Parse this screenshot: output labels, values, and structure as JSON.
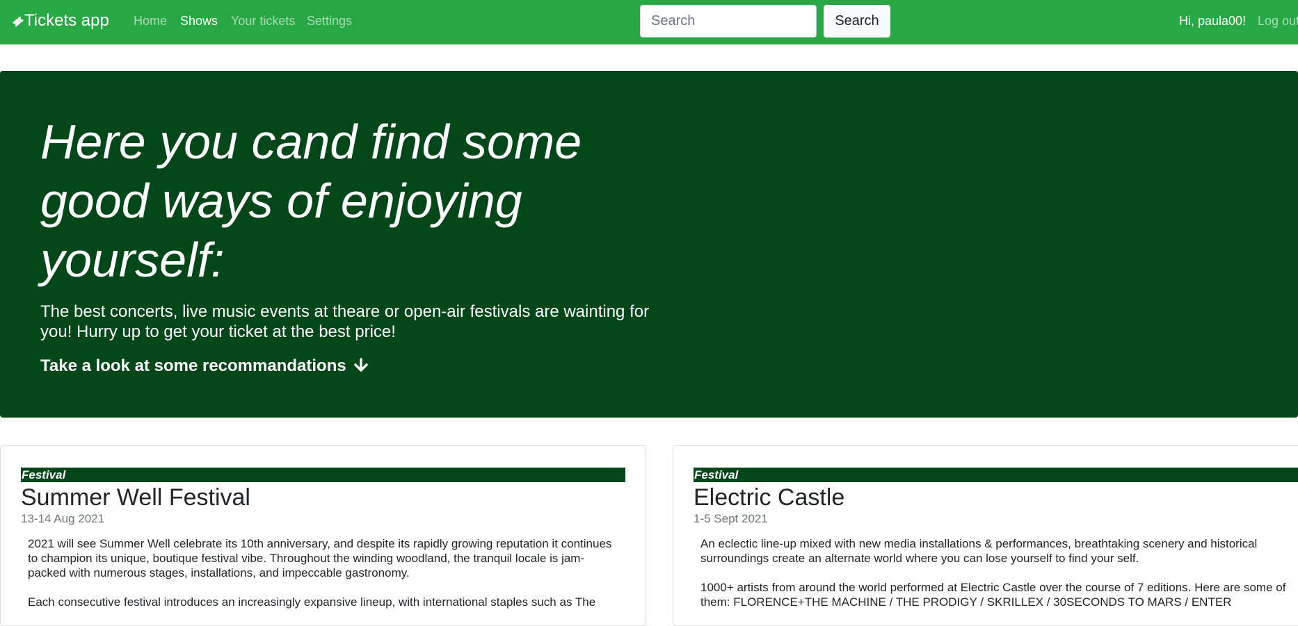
{
  "navbar": {
    "brand": "Tickets app",
    "brand_icon": "ticket-icon",
    "links": [
      "Home",
      "Shows",
      "Your tickets",
      "Settings"
    ],
    "active_link": "Shows",
    "search_placeholder": "Search",
    "search_button": "Search",
    "greeting": "Hi, paula00!",
    "logout": "Log out"
  },
  "hero": {
    "title": "Here you cand find some good ways of enjoying yourself:",
    "lead": "The best concerts, live music events at theare or open-air festivals are wainting for you! Hurry up to get your ticket at the best price!",
    "cta": "Take a look at some recommandations",
    "cta_icon": "arrow-down-icon"
  },
  "cards": [
    {
      "category": "Festival",
      "title": "Summer Well Festival",
      "date": "13-14 Aug 2021",
      "paragraphs": [
        "2021 will see Summer Well celebrate its 10th anniversary, and despite its rapidly growing reputation it continues to champion its unique, boutique festival vibe. Throughout the winding woodland, the tranquil locale is jam-packed with numerous stages, installations, and impeccable gastronomy.",
        "Each consecutive festival introduces an increasingly expansive lineup, with international staples such as The"
      ]
    },
    {
      "category": "Festival",
      "title": "Electric Castle",
      "date": "1-5 Sept 2021",
      "paragraphs": [
        "An eclectic line-up mixed with new media installations & performances, breathtaking scenery and historical surroundings create an alternate world where you can lose yourself to find your self.",
        "1000+ artists from around the world performed at Electric Castle over the course of 7 editions. Here are some of them: FLORENCE+THE MACHINE / THE PRODIGY / SKRILLEX / 30SECONDS TO MARS / ENTER"
      ]
    }
  ],
  "colors": {
    "navbar": "#28a745",
    "hero": "#034619",
    "badge": "#034619"
  }
}
